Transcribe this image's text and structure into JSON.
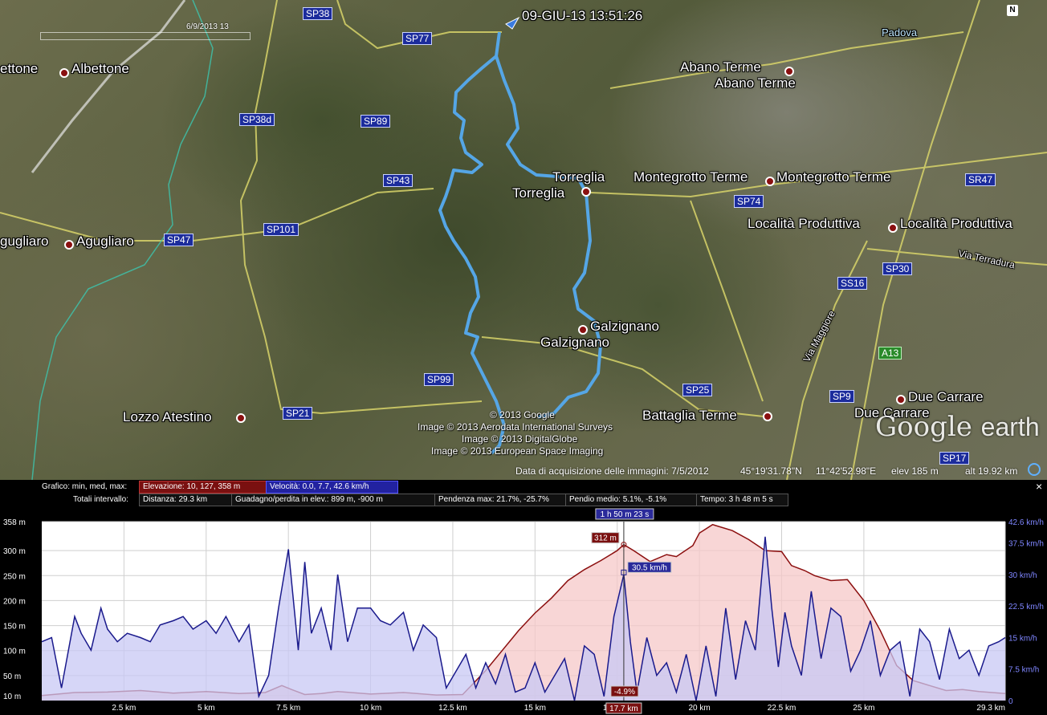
{
  "map": {
    "track_timestamp": "09-GIU-13 13:51:26",
    "time_slider_label": "6/9/2013  13",
    "compass_label": "N",
    "places": [
      {
        "id": "albettone-l",
        "text": "ettone"
      },
      {
        "id": "albettone",
        "text": "Albettone"
      },
      {
        "id": "agugliaro-l",
        "text": "gugliaro"
      },
      {
        "id": "agugliaro",
        "text": "Agugliaro"
      },
      {
        "id": "lozzo",
        "text": "Lozzo Atestino"
      },
      {
        "id": "padova",
        "text": "Padova"
      },
      {
        "id": "abano1",
        "text": "Abano Terme"
      },
      {
        "id": "abano2",
        "text": "Abano Terme"
      },
      {
        "id": "torreglia1",
        "text": "Torreglia"
      },
      {
        "id": "torreglia2",
        "text": "Torreglia"
      },
      {
        "id": "montegrotto1",
        "text": "Montegrotto Terme"
      },
      {
        "id": "montegrotto2",
        "text": "Montegrotto Terme"
      },
      {
        "id": "localita1",
        "text": "Località Produttiva"
      },
      {
        "id": "localita2",
        "text": "Località Produttiva"
      },
      {
        "id": "galzignano1",
        "text": "Galzignano"
      },
      {
        "id": "galzignano2",
        "text": "Galzignano"
      },
      {
        "id": "battaglia",
        "text": "Battaglia Terme"
      },
      {
        "id": "duecarrare1",
        "text": "Due Carrare"
      },
      {
        "id": "duecarrare2",
        "text": "Due Carrare"
      },
      {
        "id": "via-terradura",
        "text": "Via Terradura"
      },
      {
        "id": "via-maggiore",
        "text": "Via Maggiore"
      }
    ],
    "road_shields": [
      "SP38",
      "SP77",
      "SP38d",
      "SP89",
      "SP43",
      "SP101",
      "SP47",
      "SP99",
      "SP21",
      "SP74",
      "SP47",
      "SP30",
      "SS16",
      "SP25",
      "SP9",
      "SP17",
      "SR47"
    ],
    "motorway_shield": "A13",
    "copyright_lines": [
      "© 2013 Google",
      "Image © 2013 Aerodata International Surveys",
      "Image © 2013 DigitalGlobe",
      "Image © 2013 European Space Imaging"
    ],
    "logo_text_1": "Google",
    "logo_text_2": "earth",
    "status": {
      "acquisition": "Data di acquisizione delle immagini: 7/5/2012",
      "latitude": "45°19'31.78\"N",
      "longitude": "11°42'52.98\"E",
      "elev": "elev   185 m",
      "alt": "alt  19.92 km"
    }
  },
  "profile": {
    "graph_label": "Grafico: min, med, max:",
    "elevation_chip": "Elevazione: 10, 127, 358 m",
    "speed_chip": "Velocità: 0.0, 7.7, 42.6 km/h",
    "totals_label": "Totali intervallo:",
    "distance_chip": "Distanza: 29.3 km",
    "gain_chip": "Guadagno/perdita in elev.: 899 m, -900 m",
    "slope_max_chip": "Pendenza max: 21.7%, -25.7%",
    "slope_avg_chip": "Pendio medio: 5.1%, -5.1%",
    "time_chip": "Tempo: 3 h 48 m 5 s",
    "close_label": "×",
    "cursor_time": "1 h 50 m 23 s",
    "cursor_elevation": "312 m",
    "cursor_speed": "30.5 km/h",
    "cursor_slope": "-4.9%",
    "cursor_distance": "17.7 km"
  },
  "chart_data": {
    "type": "area",
    "xlabel": "",
    "x_ticks": [
      "2.5 km",
      "5 km",
      "7.5 km",
      "10 km",
      "12.5 km",
      "15 km",
      "17.5 km",
      "20 km",
      "22.5 km",
      "25 km",
      "29.3 km"
    ],
    "x_tick_values": [
      2.5,
      5,
      7.5,
      10,
      12.5,
      15,
      17.5,
      20,
      22.5,
      25,
      29.3
    ],
    "xlim": [
      0,
      29.3
    ],
    "y_left_ticks": [
      "358 m",
      "300 m",
      "250 m",
      "200 m",
      "150 m",
      "100 m",
      "50 m",
      "10 m"
    ],
    "y_left_values": [
      358,
      300,
      250,
      200,
      150,
      100,
      50,
      10
    ],
    "ylim_left": [
      0,
      358
    ],
    "y_right_ticks": [
      "42.6 km/h",
      "37.5 km/h",
      "30 km/h",
      "22.5 km/h",
      "15 km/h",
      "7.5 km/h",
      "0"
    ],
    "y_right_values": [
      42.6,
      37.5,
      30,
      22.5,
      15,
      7.5,
      0
    ],
    "ylim_right": [
      0,
      42.6
    ],
    "grid": true,
    "cursor_x": 17.7,
    "series": [
      {
        "name": "Elevazione",
        "unit": "m",
        "color": "#8b0e0e",
        "fill": "#f6c8c8",
        "x": [
          0,
          1,
          2,
          3,
          4,
          5,
          6,
          6.8,
          7.3,
          7.6,
          8,
          8.5,
          9,
          10,
          11,
          12,
          12.8,
          13.5,
          14,
          14.5,
          15,
          15.5,
          16,
          16.5,
          17,
          17.5,
          17.7,
          18,
          18.5,
          19,
          19.3,
          19.8,
          20,
          20.4,
          21,
          21.5,
          22,
          22.5,
          22.8,
          23.2,
          23.5,
          24,
          24.5,
          25,
          25.5,
          26,
          26.5,
          27,
          27.5,
          28,
          28.5,
          29.3
        ],
        "values": [
          10,
          16,
          17,
          20,
          15,
          18,
          14,
          16,
          30,
          22,
          12,
          14,
          18,
          13,
          16,
          11,
          12,
          60,
          100,
          140,
          175,
          205,
          240,
          262,
          280,
          300,
          312,
          300,
          278,
          292,
          288,
          310,
          335,
          352,
          340,
          322,
          300,
          298,
          270,
          260,
          250,
          240,
          242,
          200,
          140,
          70,
          40,
          30,
          20,
          22,
          18,
          14
        ]
      },
      {
        "name": "Velocità",
        "unit": "km/h",
        "color": "#1a1a8c",
        "fill": "#c8c8f4",
        "x": [
          0,
          0.3,
          0.6,
          1,
          1.2,
          1.5,
          1.8,
          2,
          2.3,
          2.6,
          3,
          3.3,
          3.6,
          4,
          4.3,
          4.6,
          5,
          5.3,
          5.6,
          6,
          6.3,
          6.6,
          6.9,
          7.2,
          7.5,
          7.8,
          8,
          8.2,
          8.5,
          8.8,
          9,
          9.3,
          9.6,
          10,
          10.3,
          10.6,
          11,
          11.3,
          11.6,
          12,
          12.3,
          12.6,
          12.9,
          13.2,
          13.5,
          13.8,
          14.1,
          14.4,
          14.7,
          15,
          15.3,
          15.6,
          15.9,
          16.2,
          16.5,
          16.8,
          17.1,
          17.4,
          17.7,
          17.9,
          18.1,
          18.4,
          18.7,
          19,
          19.3,
          19.6,
          19.9,
          20.2,
          20.5,
          20.8,
          21.1,
          21.4,
          21.7,
          22,
          22.2,
          22.4,
          22.6,
          22.8,
          23.1,
          23.4,
          23.7,
          24,
          24.3,
          24.6,
          24.9,
          25.2,
          25.5,
          25.8,
          26.1,
          26.4,
          26.7,
          27,
          27.3,
          27.6,
          27.9,
          28.2,
          28.5,
          28.8,
          29.1,
          29.3
        ],
        "values": [
          14,
          15,
          3,
          20,
          16,
          12,
          22,
          17,
          14,
          16,
          15,
          14,
          18,
          19,
          20,
          17,
          19,
          16,
          20,
          14,
          18,
          1,
          6,
          22,
          36,
          12,
          33,
          16,
          22,
          12,
          30,
          14,
          22,
          22,
          19,
          18,
          21,
          12,
          18,
          15,
          3,
          7,
          11,
          3,
          9,
          4,
          11,
          2,
          3,
          9,
          2,
          6,
          10,
          0,
          13,
          11,
          1,
          20,
          30,
          14,
          2,
          15,
          6,
          9,
          2,
          11,
          0,
          13,
          1,
          22,
          5,
          19,
          12,
          39,
          22,
          8,
          21,
          13,
          6,
          26,
          10,
          22,
          20,
          7,
          12,
          19,
          6,
          12,
          14,
          1,
          17,
          14,
          5,
          17,
          10,
          12,
          6,
          13,
          14,
          15
        ]
      }
    ]
  }
}
